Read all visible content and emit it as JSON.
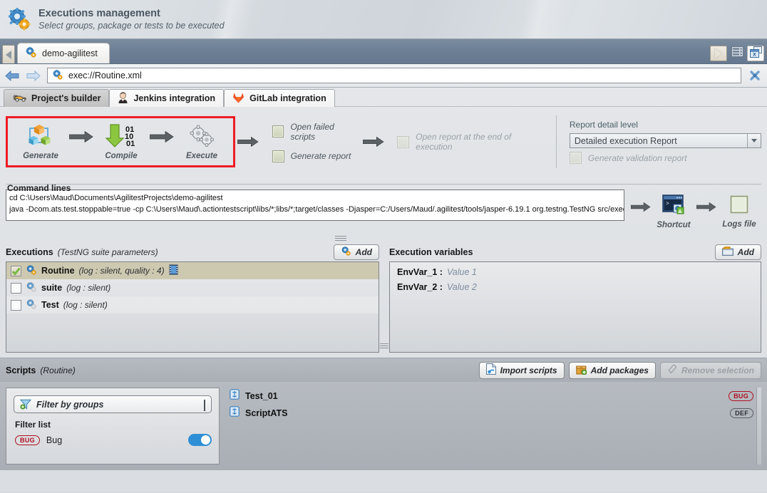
{
  "header": {
    "title": "Executions management",
    "subtitle": "Select groups, package or tests to be executed",
    "icon": "gears-icon"
  },
  "tabstrip": {
    "scroll_left_icon": "triangle-left-icon",
    "project_tab": {
      "label": "demo-agilitest",
      "icon": "gears-icon"
    },
    "buttons": [
      {
        "name": "play-button",
        "icon": "play-triangle-icon"
      },
      {
        "name": "list-view-button",
        "icon": "list-icon"
      },
      {
        "name": "close-all-tabs-button",
        "icon": "windows-close-icon"
      }
    ]
  },
  "addressbar": {
    "back_icon": "arrow-left-icon",
    "forward_icon": "arrow-right-icon",
    "url": "exec://Routine.xml",
    "url_icon": "gears-icon",
    "close_icon": "close-cross-icon"
  },
  "subtabs": [
    {
      "label": "Project's builder",
      "icon": "car-icon",
      "active": true
    },
    {
      "label": "Jenkins integration",
      "icon": "jenkins-butler-icon",
      "active": false
    },
    {
      "label": "GitLab integration",
      "icon": "gitlab-fox-icon",
      "active": false
    }
  ],
  "builder": {
    "steps": [
      {
        "label": "Generate",
        "icon": "cubes-icon"
      },
      {
        "label": "Compile",
        "icon": "binary-arrow-icon"
      },
      {
        "label": "Execute",
        "icon": "gears-icon"
      }
    ],
    "options": [
      {
        "label": "Open failed scripts",
        "checked": false,
        "enabled": true
      },
      {
        "label": "Generate report",
        "checked": false,
        "enabled": true
      }
    ],
    "open_report_option": {
      "label": "Open  report at the end of execution",
      "checked": false,
      "enabled": false
    },
    "report": {
      "title": "Report detail level",
      "selected": "Detailed execution Report",
      "validation_option": {
        "label": "Generate validation report",
        "checked": false,
        "enabled": false
      }
    }
  },
  "command_lines": {
    "legend": "Command lines",
    "line1": "cd C:\\Users\\Maud\\Documents\\AgilitestProjects\\demo-agilitest",
    "line2": "java -Dcom.ats.test.stoppable=true -cp C:\\Users\\Maud\\.actiontestscript\\libs/*;libs/*;target/classes -Djasper=C:/Users/Maud/.agilitest/tools/jasper-6.19.1 org.testng.TestNG src/exec/Rout",
    "shortcut": {
      "label": "Shortcut",
      "icon": "console-shortcut-icon"
    },
    "logs": {
      "label": "Logs file",
      "icon": "logs-file-icon"
    }
  },
  "executions": {
    "title": "Executions",
    "subtitle": "(TestNG suite parameters)",
    "add_label": "Add",
    "add_icon": "gears-icon",
    "rows": [
      {
        "name": "Routine",
        "meta": "(log : silent, quality : 4)",
        "checked": true,
        "selected": true,
        "icon": "gears-icon",
        "extra_icon": "film-strip-icon"
      },
      {
        "name": "suite",
        "meta": "(log : silent)",
        "checked": false,
        "selected": false,
        "icon": "gears-icon",
        "extra_icon": null
      },
      {
        "name": "Test",
        "meta": "(log : silent)",
        "checked": false,
        "selected": false,
        "icon": "gears-icon",
        "extra_icon": null
      }
    ]
  },
  "execution_variables": {
    "title": "Execution variables",
    "add_label": "Add",
    "add_icon": "folder-icon",
    "rows": [
      {
        "name": "EnvVar_1 :",
        "value": "Value 1"
      },
      {
        "name": "EnvVar_2 :",
        "value": "Value 2"
      }
    ]
  },
  "scripts": {
    "title": "Scripts",
    "subtitle": "(Routine)",
    "buttons": [
      {
        "label": "Import scripts",
        "icon": "import-file-icon",
        "enabled": true
      },
      {
        "label": "Add packages",
        "icon": "package-add-icon",
        "enabled": true
      },
      {
        "label": "Remove selection",
        "icon": "eraser-icon",
        "enabled": false
      }
    ],
    "filter": {
      "select_label": "Filter by groups",
      "select_icon": "funnel-icon",
      "list_label": "Filter list",
      "items": [
        {
          "badge": "BUG",
          "label": "Bug",
          "enabled": true
        }
      ]
    },
    "list": [
      {
        "name": "Test_01",
        "icon": "script-icon",
        "badge": "BUG",
        "badge_type": "bug"
      },
      {
        "name": "ScriptATS",
        "icon": "script-icon",
        "badge": "DEF",
        "badge_type": "def"
      }
    ]
  },
  "colors": {
    "highlight_box": "#ee1c25",
    "accent_blue": "#2f8fd6",
    "bug_red": "#b01020",
    "header_text": "#4a5660"
  }
}
